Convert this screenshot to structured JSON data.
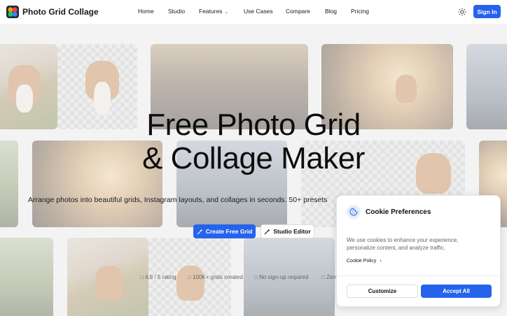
{
  "nav": {
    "brand": "Photo Grid Collage",
    "links": [
      {
        "label": "Home"
      },
      {
        "label": "Studio"
      },
      {
        "label": "Features",
        "has_dropdown": true
      },
      {
        "label": "Use Cases"
      },
      {
        "label": "Compare"
      },
      {
        "label": "Blog"
      },
      {
        "label": "Pricing"
      }
    ],
    "theme_icon": "sun-icon",
    "signin_label": "Sign In"
  },
  "hero": {
    "title_line1": "Free Photo Grid",
    "title_line2": "& Collage Maker",
    "subtitle": "Arrange photos into beautiful grids, Instagram layouts, and collages in seconds. 50+ presets",
    "primary_cta": "Create Free Grid",
    "secondary_cta": "Studio Editor",
    "stats": [
      "4.8 / 5 rating",
      "100K+ grids created",
      "No sign-up required",
      "Zero"
    ]
  },
  "cookie": {
    "title": "Cookie Preferences",
    "body": "We use cookies to enhance your experience, personalize content, and analyze traffic.",
    "policy_link": "Cookie Policy",
    "customize_label": "Customize",
    "accept_label": "Accept All"
  },
  "colors": {
    "primary": "#2563eb",
    "text": "#111111",
    "muted": "#666666",
    "background": "#f3f3f3"
  }
}
